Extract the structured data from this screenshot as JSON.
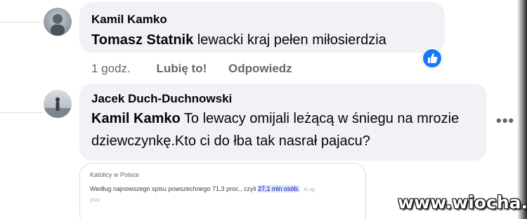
{
  "comments": [
    {
      "author": "Kamil Kamko",
      "mention": "Tomasz Statnik",
      "text": "lewacki kraj pełen miłosierdzia",
      "time": "1 godz.",
      "like_label": "Lubię to!",
      "reply_label": "Odpowiedz",
      "reaction_icon": "thumbs-up-icon"
    },
    {
      "author": "Jacek Duch-Duchnowski",
      "mention": "Kamil Kamko",
      "text": "To lewacy omijali leżącą w śniegu na mrozie dziewczynkę.Kto ci do łba tak nasrał pajacu?",
      "more_icon": "•••"
    }
  ],
  "attachment": {
    "source": "Katolicy w Polsce",
    "text_before": "Według najnowszego spisu powszechnego 71,3 proc., czyli ",
    "highlight": "27,1 mln osób.",
    "date": "31 sty 2023"
  },
  "watermark": "www.wiocha.pl",
  "colors": {
    "bubble": "#f0f2f5",
    "like_badge": "#1877f2",
    "meta_text": "#65676b"
  }
}
